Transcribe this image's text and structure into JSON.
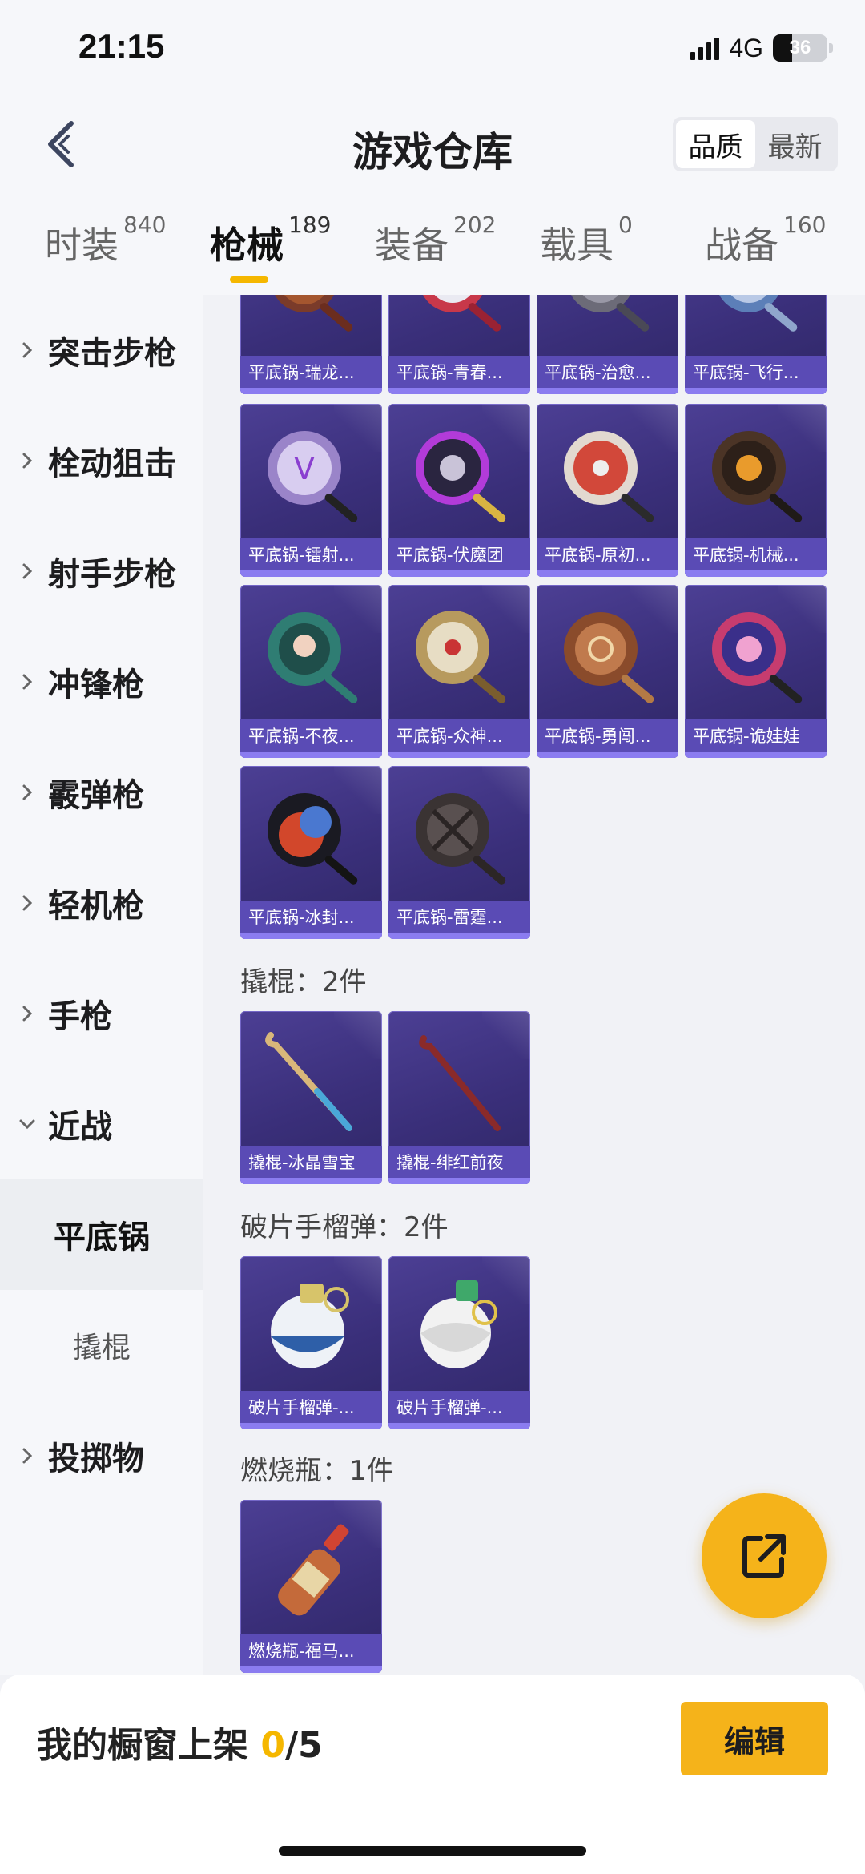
{
  "status_bar": {
    "time": "21:15",
    "network": "4G",
    "battery": "36",
    "battery_level": 0.36
  },
  "header": {
    "title": "游戏仓库",
    "back_icon": "chevron-left-icon",
    "sort_options": [
      "品质",
      "最新"
    ],
    "sort_selected": "品质"
  },
  "tabs": [
    {
      "label": "时装",
      "count": "840",
      "active": false
    },
    {
      "label": "枪械",
      "count": "189",
      "active": true
    },
    {
      "label": "装备",
      "count": "202",
      "active": false
    },
    {
      "label": "载具",
      "count": "0",
      "active": false
    },
    {
      "label": "战备",
      "count": "160",
      "active": false
    }
  ],
  "sidebar": {
    "items": [
      {
        "label": "突击步枪",
        "expanded": false
      },
      {
        "label": "栓动狙击",
        "expanded": false
      },
      {
        "label": "射手步枪",
        "expanded": false
      },
      {
        "label": "冲锋枪",
        "expanded": false
      },
      {
        "label": "霰弹枪",
        "expanded": false
      },
      {
        "label": "轻机枪",
        "expanded": false
      },
      {
        "label": "手枪",
        "expanded": false
      },
      {
        "label": "近战",
        "expanded": true
      }
    ],
    "sub_items": [
      {
        "label": "平底锅",
        "active": true
      },
      {
        "label": "撬棍",
        "active": false
      }
    ],
    "last_item": {
      "label": "投掷物",
      "expanded": false
    }
  },
  "sections": {
    "pans": {
      "items": [
        "平底锅-瑞龙...",
        "平底锅-青春...",
        "平底锅-治愈...",
        "平底锅-飞行...",
        "平底锅-镭射...",
        "平底锅-伏魔团",
        "平底锅-原初...",
        "平底锅-机械...",
        "平底锅-不夜...",
        "平底锅-众神...",
        "平底锅-勇闯...",
        "平底锅-诡娃娃",
        "平底锅-冰封...",
        "平底锅-雷霆..."
      ]
    },
    "crowbar": {
      "title": "撬棍：2件",
      "items": [
        "撬棍-冰晶雪宝",
        "撬棍-绯红前夜"
      ]
    },
    "grenade": {
      "title": "破片手榴弹：2件",
      "items": [
        "破片手榴弹-...",
        "破片手榴弹-..."
      ]
    },
    "molotov": {
      "title": "燃烧瓶：1件",
      "items": [
        "燃烧瓶-福马..."
      ]
    }
  },
  "fab": {
    "icon": "share-external-icon"
  },
  "bottom_bar": {
    "label": "我的橱窗上架 ",
    "current": "0",
    "total": "/5",
    "edit_label": "编辑"
  },
  "colors": {
    "accent": "#f5b31a",
    "card_bg": "#3a2f7a",
    "card_label": "#5a4bb5",
    "card_bar": "#8b7cf0"
  }
}
